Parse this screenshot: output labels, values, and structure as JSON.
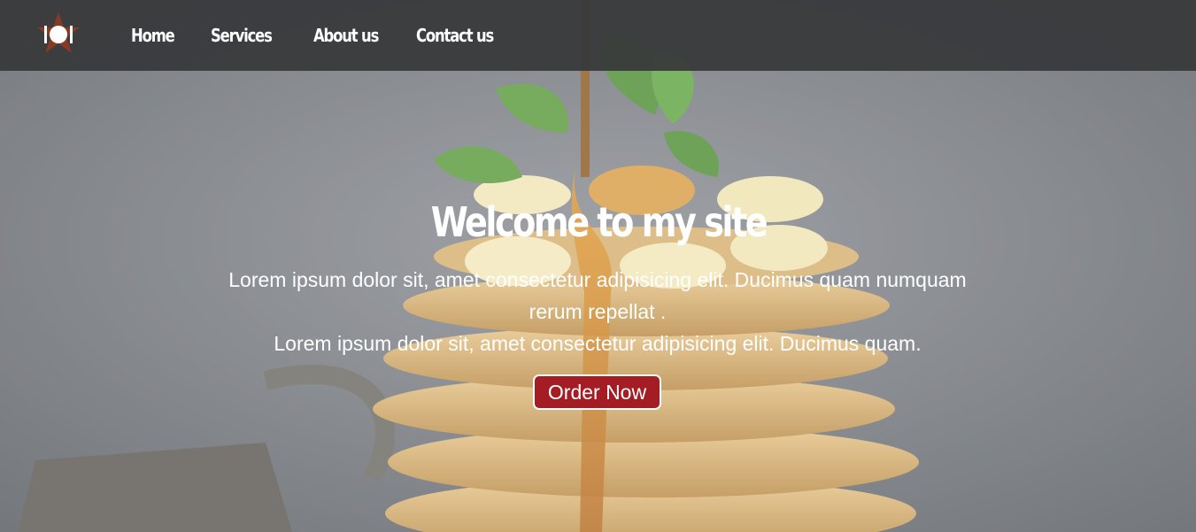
{
  "nav": {
    "logo_icon": "restaurant-star-plate-icon",
    "links": [
      {
        "label": "Home"
      },
      {
        "label": "Services"
      },
      {
        "label": "About us"
      },
      {
        "label": "Contact us"
      }
    ]
  },
  "hero": {
    "title": "Welcome to my site",
    "paragraph_line1": "Lorem ipsum dolor sit, amet consectetur adipisicing elit. Ducimus quam numquam rerum repellat .",
    "paragraph_line2": "Lorem ipsum dolor sit, amet consectetur adipisicing elit. Ducimus quam.",
    "button_label": "Order Now",
    "background_image": "pancake-stack-with-syrup-photo"
  },
  "colors": {
    "navbar": "#37383a",
    "button": "#a51d24",
    "text": "#ffffff"
  }
}
